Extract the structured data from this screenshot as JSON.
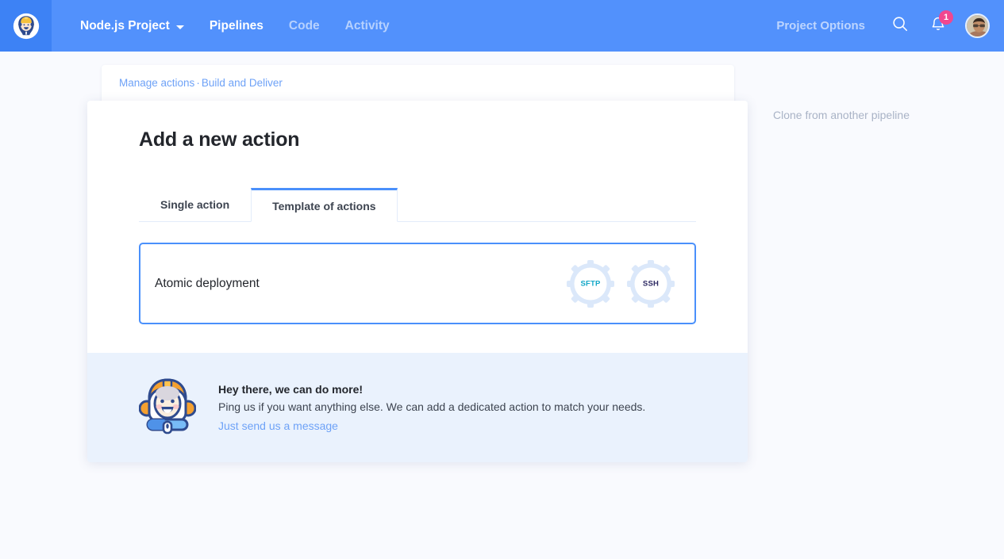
{
  "topbar": {
    "logo_icon": "astronaut-logo-icon",
    "project_name": "Node.js Project",
    "nav_items": [
      {
        "label": "Pipelines",
        "active": true
      },
      {
        "label": "Code",
        "active": false
      },
      {
        "label": "Activity",
        "active": false
      }
    ],
    "project_options": "Project Options",
    "search_icon": "search-icon",
    "notifications_icon": "bell-icon",
    "notification_count": "1",
    "avatar_icon": "user-avatar",
    "colors": {
      "background": "#5291fc",
      "logo_background": "#3d82f5",
      "badge": "#f0478f"
    }
  },
  "breadcrumb": {
    "first": "Manage actions",
    "separator": "·",
    "second": "Build and Deliver"
  },
  "modal": {
    "title": "Add a new action",
    "tabs": [
      {
        "label": "Single action",
        "active": false
      },
      {
        "label": "Template of actions",
        "active": true
      }
    ],
    "action_card": {
      "name": "Atomic deployment",
      "icons": [
        {
          "label": "SFTP",
          "name": "gear-sftp-icon",
          "color": "#15a8c8"
        },
        {
          "label": "SSH",
          "name": "gear-ssh-icon",
          "color": "#2e2a63"
        }
      ]
    },
    "footer": {
      "mascot_icon": "astronaut-mascot-icon",
      "title": "Hey there, we can do more!",
      "description": "Ping us if you want anything else. We can add a dedicated action to match your needs.",
      "link": "Just send us a message",
      "background": "#eaf2fd"
    }
  },
  "side_panel": {
    "clone_link": "Clone from another pipeline"
  }
}
